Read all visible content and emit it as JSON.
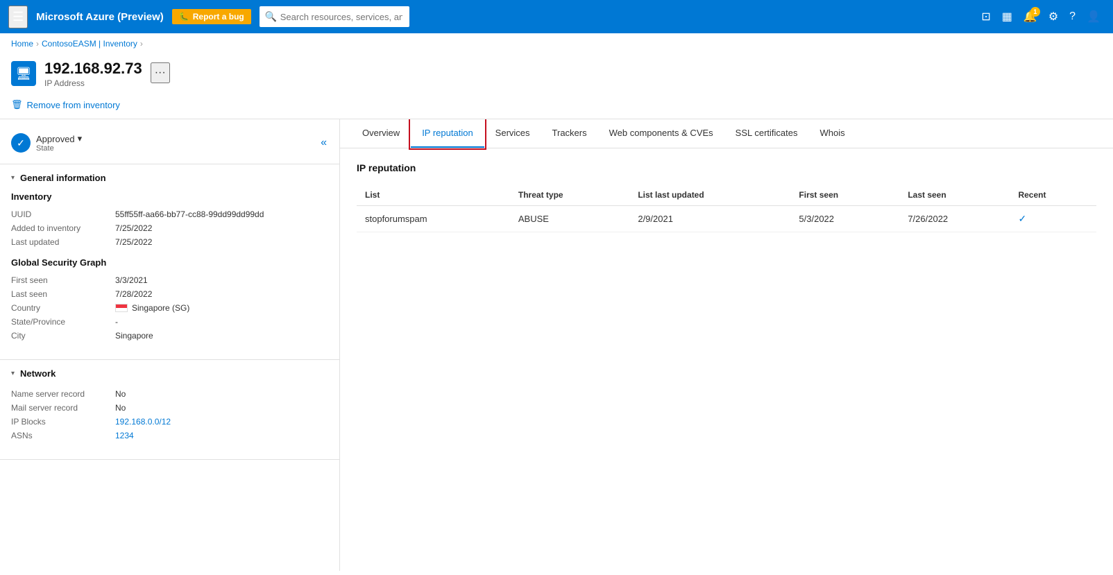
{
  "topnav": {
    "hamburger_icon": "☰",
    "title": "Microsoft Azure (Preview)",
    "bug_btn_icon": "🐛",
    "bug_btn_label": "Report a bug",
    "search_placeholder": "Search resources, services, and docs (G+/)",
    "icons": [
      {
        "name": "portal-icon",
        "symbol": "⊡"
      },
      {
        "name": "dashboard-icon",
        "symbol": "▦"
      },
      {
        "name": "notification-icon",
        "symbol": "🔔",
        "badge": "1"
      },
      {
        "name": "settings-icon",
        "symbol": "⚙"
      },
      {
        "name": "help-icon",
        "symbol": "?"
      },
      {
        "name": "account-icon",
        "symbol": "👤"
      }
    ]
  },
  "breadcrumb": {
    "items": [
      "Home",
      "ContosoEASM | Inventory"
    ],
    "current": ""
  },
  "page_header": {
    "icon_symbol": "▦",
    "title": "192.168.92.73",
    "subtitle": "IP Address",
    "more_label": "···"
  },
  "toolbar": {
    "remove_icon": "🗑",
    "remove_label": "Remove from inventory"
  },
  "left_panel": {
    "state": {
      "icon": "✓",
      "label": "Approved",
      "dropdown_icon": "▾",
      "sublabel": "State"
    },
    "collapse_icon": "«",
    "sections": [
      {
        "id": "general",
        "toggle_icon": "▾",
        "title": "General information",
        "groups": [
          {
            "title": "Inventory",
            "rows": [
              {
                "label": "UUID",
                "value": "55ff55ff-aa66-bb77-cc88-99dd99dd99dd"
              },
              {
                "label": "Added to inventory",
                "value": "7/25/2022"
              },
              {
                "label": "Last updated",
                "value": "7/25/2022"
              }
            ]
          },
          {
            "title": "Global Security Graph",
            "rows": [
              {
                "label": "First seen",
                "value": "3/3/2021"
              },
              {
                "label": "Last seen",
                "value": "7/28/2022"
              },
              {
                "label": "Country",
                "value": "Singapore (SG)",
                "has_flag": true
              },
              {
                "label": "State/Province",
                "value": "-"
              },
              {
                "label": "City",
                "value": "Singapore"
              }
            ]
          }
        ]
      },
      {
        "id": "network",
        "toggle_icon": "▾",
        "title": "Network",
        "groups": [
          {
            "title": "",
            "rows": [
              {
                "label": "Name server record",
                "value": "No"
              },
              {
                "label": "Mail server record",
                "value": "No"
              },
              {
                "label": "IP Blocks",
                "value": "192.168.0.0/12",
                "is_link": true
              },
              {
                "label": "ASNs",
                "value": "1234",
                "is_link": true
              }
            ]
          }
        ]
      }
    ]
  },
  "right_panel": {
    "tabs": [
      {
        "id": "overview",
        "label": "Overview",
        "active": false
      },
      {
        "id": "ip-reputation",
        "label": "IP reputation",
        "active": true
      },
      {
        "id": "services",
        "label": "Services",
        "active": false
      },
      {
        "id": "trackers",
        "label": "Trackers",
        "active": false
      },
      {
        "id": "web-components",
        "label": "Web components & CVEs",
        "active": false
      },
      {
        "id": "ssl-certificates",
        "label": "SSL certificates",
        "active": false
      },
      {
        "id": "whois",
        "label": "Whois",
        "active": false
      }
    ],
    "ip_reputation": {
      "title": "IP reputation",
      "table": {
        "headers": [
          "List",
          "Threat type",
          "List last updated",
          "First seen",
          "Last seen",
          "Recent"
        ],
        "rows": [
          {
            "list": "stopforumspam",
            "threat_type": "ABUSE",
            "list_last_updated": "2/9/2021",
            "first_seen": "5/3/2022",
            "last_seen": "7/26/2022",
            "recent": "✓",
            "recent_is_check": true
          }
        ]
      }
    }
  }
}
